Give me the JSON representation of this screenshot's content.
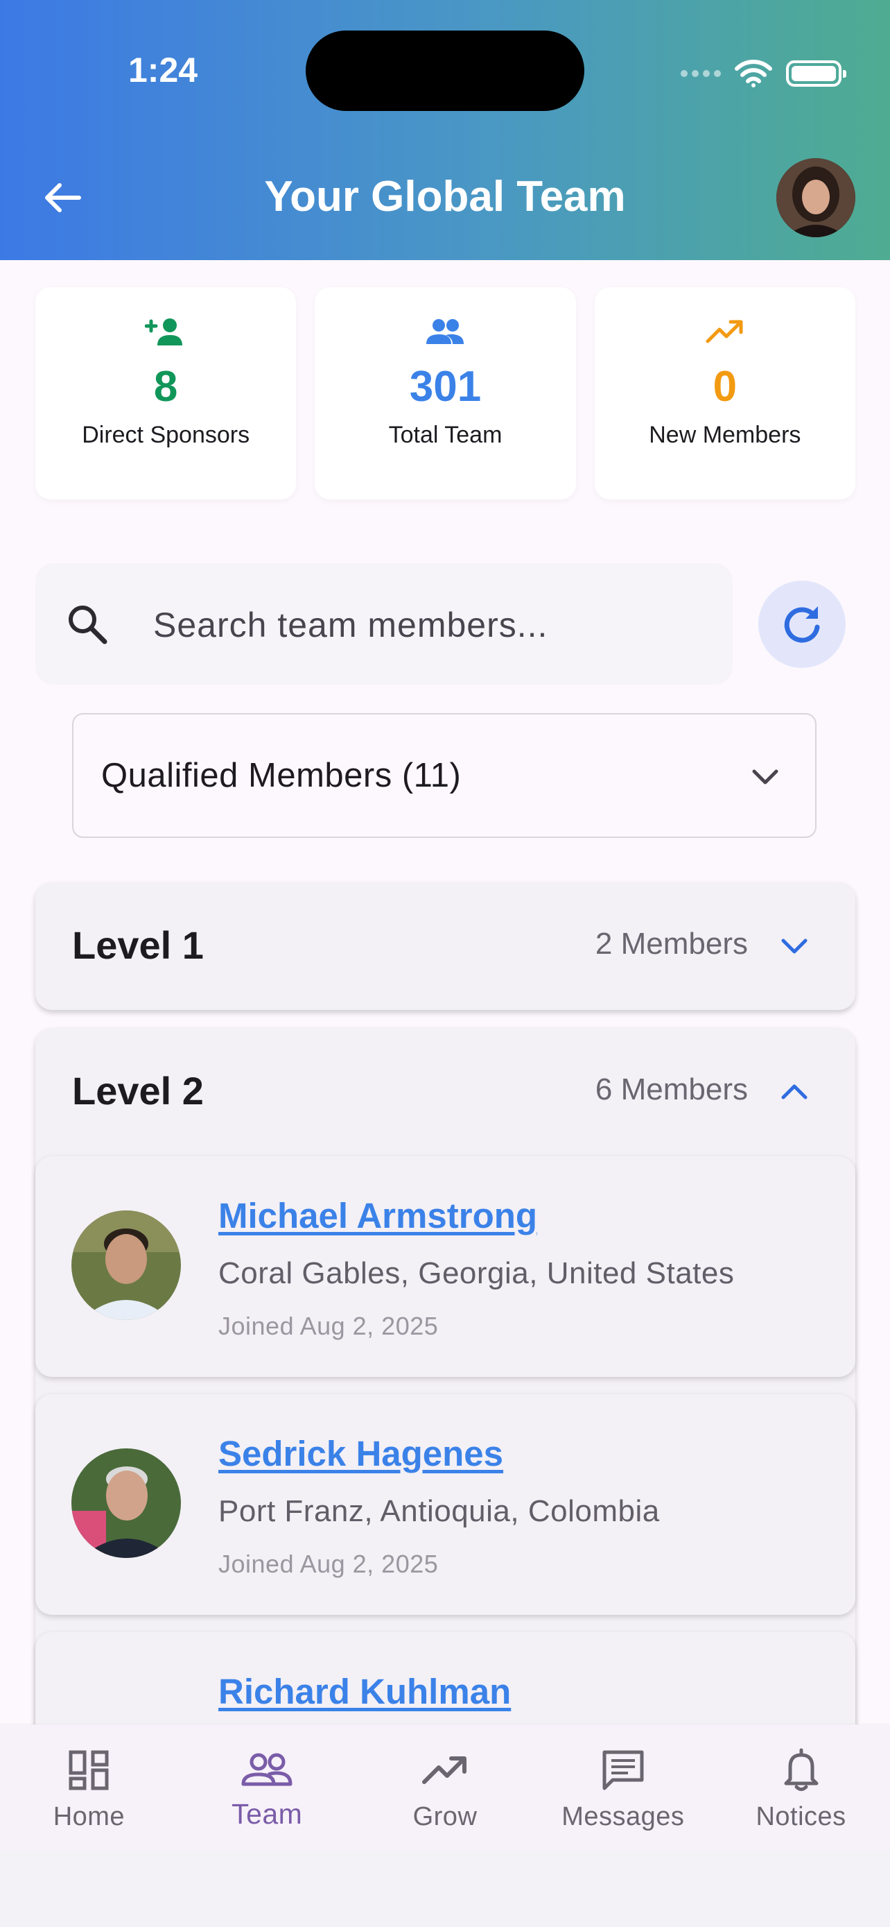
{
  "status_bar": {
    "time": "1:24"
  },
  "header": {
    "title": "Your Global Team"
  },
  "stats": [
    {
      "value": "8",
      "label": "Direct Sponsors",
      "icon": "person-add-icon",
      "color": "#11965a"
    },
    {
      "value": "301",
      "label": "Total Team",
      "icon": "group-icon",
      "color": "#3b82e8"
    },
    {
      "value": "0",
      "label": "New Members",
      "icon": "trending-up-icon",
      "color": "#f29a11"
    }
  ],
  "search": {
    "placeholder": "Search team members..."
  },
  "filter": {
    "selected": "Qualified Members (11)"
  },
  "levels": [
    {
      "title": "Level 1",
      "count": "2 Members",
      "expanded": false
    },
    {
      "title": "Level 2",
      "count": "6 Members",
      "expanded": true
    }
  ],
  "members": [
    {
      "name": "Michael Armstrong",
      "location": "Coral Gables, Georgia, United States",
      "joined": "Joined Aug 2, 2025"
    },
    {
      "name": "Sedrick Hagenes",
      "location": "Port Franz, Antioquia, Colombia",
      "joined": "Joined Aug 2, 2025"
    },
    {
      "name": "Richard Kuhlman",
      "location": "",
      "joined": ""
    }
  ],
  "nav": [
    {
      "label": "Home",
      "icon": "dashboard-icon",
      "active": false
    },
    {
      "label": "Team",
      "icon": "team-icon",
      "active": true
    },
    {
      "label": "Grow",
      "icon": "trending-up-icon",
      "active": false
    },
    {
      "label": "Messages",
      "icon": "message-icon",
      "active": false
    },
    {
      "label": "Notices",
      "icon": "bell-icon",
      "active": false
    }
  ],
  "colors": {
    "accent": "#3b82e8",
    "nav_active": "#7a5ca8",
    "green": "#11965a",
    "orange": "#f29a11"
  }
}
